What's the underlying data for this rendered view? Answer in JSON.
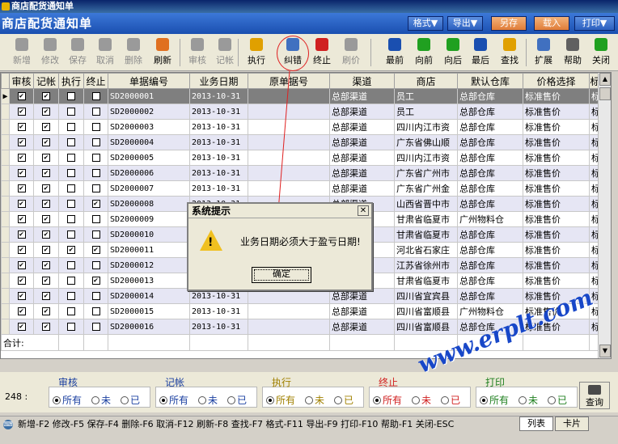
{
  "window": {
    "title": "商店配货通知单"
  },
  "header": {
    "title": "商店配货通知单",
    "buttons": [
      "格式▼",
      "导出▼",
      "另存",
      "载入",
      "打印▼"
    ]
  },
  "toolbar": {
    "items": [
      {
        "label": "新增",
        "icon": "add-icon",
        "color": "#9a9a9a",
        "disabled": true
      },
      {
        "label": "修改",
        "icon": "edit-icon",
        "color": "#9a9a9a",
        "disabled": true
      },
      {
        "label": "保存",
        "icon": "save-icon",
        "color": "#9a9a9a",
        "disabled": true
      },
      {
        "label": "取消",
        "icon": "undo-icon",
        "color": "#9a9a9a",
        "disabled": true
      },
      {
        "label": "删除",
        "icon": "delete-icon",
        "color": "#9a9a9a",
        "disabled": true
      },
      {
        "label": "刷新",
        "icon": "refresh-icon",
        "color": "#e07020",
        "disabled": false
      },
      {
        "label": "审核",
        "icon": "audit-icon",
        "color": "#9a9a9a",
        "disabled": true
      },
      {
        "label": "记帐",
        "icon": "bookkeeping-icon",
        "color": "#9a9a9a",
        "disabled": true
      },
      {
        "label": "执行",
        "icon": "execute-icon",
        "color": "#e0a000",
        "disabled": false
      },
      {
        "label": "纠错",
        "icon": "correct-icon",
        "color": "#4070c0",
        "disabled": false
      },
      {
        "label": "终止",
        "icon": "stop-icon",
        "color": "#d02020",
        "disabled": false
      },
      {
        "label": "刷价",
        "icon": "price-refresh-icon",
        "color": "#9a9a9a",
        "disabled": true
      },
      {
        "label": "最前",
        "icon": "first-icon",
        "color": "#1a4fb0",
        "disabled": false
      },
      {
        "label": "向前",
        "icon": "prev-icon",
        "color": "#20a020",
        "disabled": false
      },
      {
        "label": "向后",
        "icon": "next-icon",
        "color": "#20a020",
        "disabled": false
      },
      {
        "label": "最后",
        "icon": "last-icon",
        "color": "#1a4fb0",
        "disabled": false
      },
      {
        "label": "查找",
        "icon": "find-icon",
        "color": "#e0a000",
        "disabled": false
      },
      {
        "label": "扩展",
        "icon": "grid-icon",
        "color": "#4070c0",
        "disabled": false
      },
      {
        "label": "帮助",
        "icon": "help-icon",
        "color": "#606060",
        "disabled": false
      },
      {
        "label": "关闭",
        "icon": "close-icon",
        "color": "#20a020",
        "disabled": false
      }
    ]
  },
  "grid": {
    "columns": [
      "审核",
      "记帐",
      "执行",
      "终止",
      "单据编号",
      "业务日期",
      "原单据号",
      "渠道",
      "商店",
      "默认仓库",
      "价格选择",
      "标"
    ],
    "rows": [
      {
        "c": [
          true,
          true,
          false,
          false
        ],
        "no": "SD2000001",
        "date": "2013-10-31",
        "orig": "",
        "channel": "总部渠道",
        "shop": "员工",
        "wh": "总部仓库",
        "price": "标准售价",
        "x": "标"
      },
      {
        "c": [
          true,
          true,
          false,
          false
        ],
        "no": "SD2000002",
        "date": "2013-10-31",
        "orig": "",
        "channel": "总部渠道",
        "shop": "员工",
        "wh": "总部仓库",
        "price": "标准售价",
        "x": "标"
      },
      {
        "c": [
          true,
          true,
          false,
          false
        ],
        "no": "SD2000003",
        "date": "2013-10-31",
        "orig": "",
        "channel": "总部渠道",
        "shop": "四川内江市资",
        "wh": "总部仓库",
        "price": "标准售价",
        "x": "标"
      },
      {
        "c": [
          true,
          true,
          false,
          false
        ],
        "no": "SD2000004",
        "date": "2013-10-31",
        "orig": "",
        "channel": "总部渠道",
        "shop": "广东省佛山顺",
        "wh": "总部仓库",
        "price": "标准售价",
        "x": "标"
      },
      {
        "c": [
          true,
          true,
          false,
          false
        ],
        "no": "SD2000005",
        "date": "2013-10-31",
        "orig": "",
        "channel": "总部渠道",
        "shop": "四川内江市资",
        "wh": "总部仓库",
        "price": "标准售价",
        "x": "标"
      },
      {
        "c": [
          true,
          true,
          false,
          false
        ],
        "no": "SD2000006",
        "date": "2013-10-31",
        "orig": "",
        "channel": "总部渠道",
        "shop": "广东省广州市",
        "wh": "总部仓库",
        "price": "标准售价",
        "x": "标"
      },
      {
        "c": [
          true,
          true,
          false,
          false
        ],
        "no": "SD2000007",
        "date": "2013-10-31",
        "orig": "",
        "channel": "总部渠道",
        "shop": "广东省广州金",
        "wh": "总部仓库",
        "price": "标准售价",
        "x": "标"
      },
      {
        "c": [
          true,
          true,
          false,
          true
        ],
        "no": "SD2000008",
        "date": "2013-10-31",
        "orig": "",
        "channel": "总部渠道",
        "shop": "山西省晋中市",
        "wh": "总部仓库",
        "price": "标准售价",
        "x": "标"
      },
      {
        "c": [
          true,
          true,
          false,
          false
        ],
        "no": "SD2000009",
        "date": "2013-10-31",
        "orig": "",
        "channel": "总部渠道",
        "shop": "甘肃省临夏市",
        "wh": "广州物料仓",
        "price": "标准售价",
        "x": "标"
      },
      {
        "c": [
          true,
          true,
          false,
          false
        ],
        "no": "SD2000010",
        "date": "2013-10-31",
        "orig": "",
        "channel": "总部渠道",
        "shop": "甘肃省临夏市",
        "wh": "总部仓库",
        "price": "标准售价",
        "x": "标"
      },
      {
        "c": [
          true,
          true,
          true,
          true
        ],
        "no": "SD2000011",
        "date": "2013-10-31",
        "orig": "",
        "channel": "总部渠道",
        "shop": "河北省石家庄",
        "wh": "总部仓库",
        "price": "标准售价",
        "x": "标"
      },
      {
        "c": [
          true,
          true,
          false,
          false
        ],
        "no": "SD2000012",
        "date": "2013-10-31",
        "orig": "",
        "channel": "总部渠道",
        "shop": "江苏省徐州市",
        "wh": "总部仓库",
        "price": "标准售价",
        "x": "标"
      },
      {
        "c": [
          true,
          true,
          false,
          true
        ],
        "no": "SD2000013",
        "date": "2013-10-31",
        "orig": "",
        "channel": "总部渠道",
        "shop": "甘肃省临夏市",
        "wh": "总部仓库",
        "price": "标准售价",
        "x": "标"
      },
      {
        "c": [
          true,
          true,
          false,
          false
        ],
        "no": "SD2000014",
        "date": "2013-10-31",
        "orig": "",
        "channel": "总部渠道",
        "shop": "四川省宜宾县",
        "wh": "总部仓库",
        "price": "标准售价",
        "x": "标"
      },
      {
        "c": [
          true,
          true,
          false,
          false
        ],
        "no": "SD2000015",
        "date": "2013-10-31",
        "orig": "",
        "channel": "总部渠道",
        "shop": "四川省富顺县",
        "wh": "广州物料仓",
        "price": "标准售价",
        "x": "标"
      },
      {
        "c": [
          true,
          true,
          false,
          false
        ],
        "no": "SD2000016",
        "date": "2013-10-31",
        "orig": "",
        "channel": "总部渠道",
        "shop": "四川省富顺县",
        "wh": "总部仓库",
        "price": "标准售价",
        "x": "标"
      }
    ],
    "total_label": "合计:"
  },
  "filters": {
    "count": "248 :",
    "groups": [
      {
        "title": "审核",
        "color": "#1a3fa0",
        "options": [
          "所有",
          "未",
          "已"
        ],
        "selected": 0
      },
      {
        "title": "记帐",
        "color": "#1a3fa0",
        "options": [
          "所有",
          "未",
          "已"
        ],
        "selected": 0
      },
      {
        "title": "执行",
        "color": "#a08000",
        "options": [
          "所有",
          "未",
          "已"
        ],
        "selected": 0
      },
      {
        "title": "终止",
        "color": "#d02020",
        "options": [
          "所有",
          "未",
          "已"
        ],
        "selected": 0
      },
      {
        "title": "打印",
        "color": "#208020",
        "options": [
          "所有",
          "未",
          "已"
        ],
        "selected": 0
      }
    ],
    "query_label": "查询"
  },
  "status": {
    "shortcuts": "新增-F2  修改-F5  保存-F4   删除-F6  取消-F12  刷新-F8  查找-F7  格式-F11  导出-F9  打印-F10  帮助-F1  关闭-ESC",
    "tabs": [
      "列表",
      "卡片"
    ]
  },
  "dialog": {
    "title": "系统提示",
    "message": "业务日期必须大于盈亏日期!",
    "ok_label": "确定",
    "close_glyph": "✕"
  },
  "watermark": "www.erplt.com"
}
